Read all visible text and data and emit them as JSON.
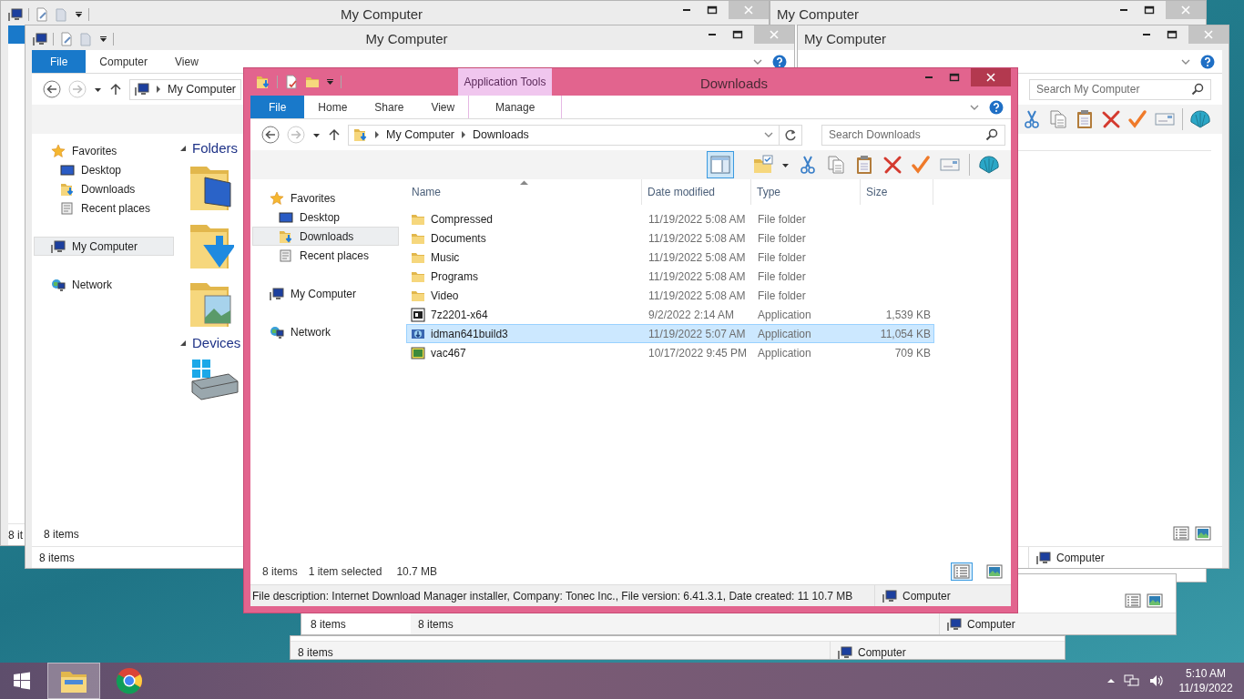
{
  "back_windows": [
    {
      "kind": "stub",
      "title": "My Computer",
      "status": "8 it"
    },
    {
      "kind": "titlebar",
      "title": "My Computer"
    },
    {
      "kind": "explorer",
      "title": "My Computer",
      "ribbon_tabs": [
        {
          "label": "File",
          "selected": true
        },
        {
          "label": "Computer",
          "selected": false
        },
        {
          "label": "View",
          "selected": false
        }
      ],
      "address": [
        "My Computer"
      ],
      "nav": [
        {
          "label": "Favorites",
          "kind": "star",
          "selected": false,
          "children": [
            {
              "label": "Desktop",
              "kind": "desktop",
              "selected": false
            },
            {
              "label": "Downloads",
              "kind": "downloads",
              "selected": false
            },
            {
              "label": "Recent places",
              "kind": "recent",
              "selected": false
            }
          ]
        },
        {
          "label": "My Computer",
          "kind": "computer",
          "selected": true
        },
        {
          "label": "Network",
          "kind": "network",
          "selected": false
        }
      ],
      "groups": [
        {
          "label": "Folders",
          "expanded": true,
          "icons": [
            {
              "kind": "desktop"
            },
            {
              "kind": "downloads"
            },
            {
              "kind": "pictures"
            }
          ]
        },
        {
          "label": "Devices",
          "expanded": true,
          "icons": [
            {
              "kind": "drive"
            }
          ]
        }
      ],
      "item_count": "8 items",
      "status": "8 items"
    },
    {
      "kind": "side",
      "title": "My Computer",
      "search_placeholder": "Search My Computer",
      "location": "Computer"
    },
    {
      "kind": "strip",
      "pane_status": "8 items",
      "status": "8 items",
      "location": "Computer"
    },
    {
      "kind": "strip",
      "status": "8 items",
      "location": "Computer"
    }
  ],
  "main_window": {
    "title": "Downloads",
    "context_tab": "Application Tools",
    "ribbon_tabs": [
      {
        "label": "File",
        "selected": true,
        "context": false
      },
      {
        "label": "Home",
        "selected": false,
        "context": false
      },
      {
        "label": "Share",
        "selected": false,
        "context": false
      },
      {
        "label": "View",
        "selected": false,
        "context": false
      },
      {
        "label": "Manage",
        "selected": false,
        "context": true
      }
    ],
    "address": [
      "My Computer",
      "Downloads"
    ],
    "search_placeholder": "Search Downloads",
    "preview_pane": {
      "selected": true
    },
    "nav": [
      {
        "label": "Favorites",
        "kind": "star",
        "selected": false,
        "children": [
          {
            "label": "Desktop",
            "kind": "desktop",
            "selected": false
          },
          {
            "label": "Downloads",
            "kind": "downloads",
            "selected": true
          },
          {
            "label": "Recent places",
            "kind": "recent",
            "selected": false
          }
        ]
      },
      {
        "label": "My Computer",
        "kind": "computer",
        "selected": false
      },
      {
        "label": "Network",
        "kind": "network",
        "selected": false
      }
    ],
    "columns": [
      {
        "label": "Name",
        "sorted": true
      },
      {
        "label": "Date modified",
        "sorted": false
      },
      {
        "label": "Type",
        "sorted": false
      },
      {
        "label": "Size",
        "sorted": false
      }
    ],
    "rows": [
      {
        "kind": "folder",
        "name": "Compressed",
        "date": "11/19/2022 5:08 AM",
        "type": "File folder",
        "selected": false
      },
      {
        "kind": "folder",
        "name": "Documents",
        "date": "11/19/2022 5:08 AM",
        "type": "File folder",
        "selected": false
      },
      {
        "kind": "folder",
        "name": "Music",
        "date": "11/19/2022 5:08 AM",
        "type": "File folder",
        "selected": false
      },
      {
        "kind": "folder",
        "name": "Programs",
        "date": "11/19/2022 5:08 AM",
        "type": "File folder",
        "selected": false
      },
      {
        "kind": "folder",
        "name": "Video",
        "date": "11/19/2022 5:08 AM",
        "type": "File folder",
        "selected": false
      },
      {
        "kind": "archiver",
        "name": "7z2201-x64",
        "date": "9/2/2022 2:14 AM",
        "type": "Application",
        "size": "1,539 KB",
        "selected": false
      },
      {
        "kind": "downloader",
        "name": "idman641build3",
        "date": "11/19/2022 5:07 AM",
        "type": "Application",
        "size": "11,054 KB",
        "selected": true
      },
      {
        "kind": "installer",
        "name": "vac467",
        "date": "10/17/2022 9:45 PM",
        "type": "Application",
        "size": "709 KB",
        "selected": false
      }
    ],
    "status": {
      "count": "8 items",
      "selection": "1 item selected",
      "size": "10.7 MB"
    },
    "views": [
      {
        "kind": "details",
        "selected": true
      },
      {
        "kind": "large",
        "selected": false
      }
    ],
    "details": "File description: Internet Download Manager installer, Company: Tonec Inc., File version: 6.41.3.1, Date created: 11 10.7 MB",
    "location": "Computer"
  },
  "taskbar": {
    "apps": [
      {
        "kind": "explorer",
        "active": true
      },
      {
        "kind": "chrome",
        "active": false
      }
    ],
    "time": "5:10 AM",
    "date": "11/19/2022"
  }
}
